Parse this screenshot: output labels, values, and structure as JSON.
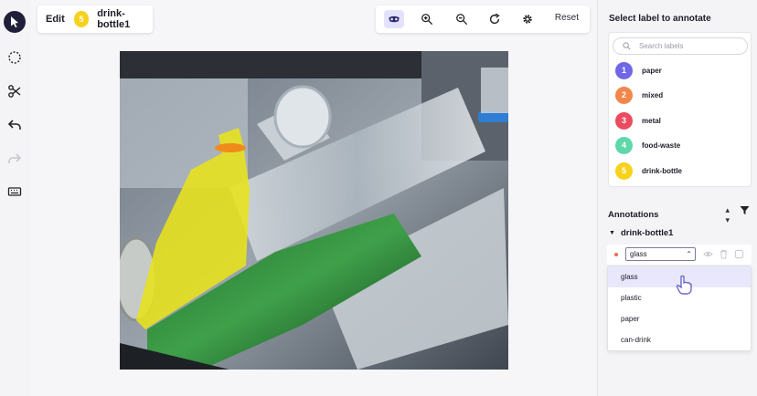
{
  "toolbar": {
    "tools": [
      {
        "name": "select-tool",
        "icon": "pointer-icon"
      },
      {
        "name": "lasso-tool",
        "icon": "dashed-circle-icon"
      },
      {
        "name": "cut-tool",
        "icon": "scissors-icon"
      },
      {
        "name": "undo-tool",
        "icon": "undo-icon"
      },
      {
        "name": "redo-tool",
        "icon": "redo-icon"
      },
      {
        "name": "keyboard-tool",
        "icon": "keyboard-icon"
      }
    ]
  },
  "editor": {
    "mode_label": "Edit",
    "selected_badge": "5",
    "selected_name": "drink-bottle1",
    "selected_color": "#f6d21b"
  },
  "view_controls": {
    "reset_label": "Reset",
    "buttons": [
      "mask-visibility-icon",
      "zoom-in-icon",
      "zoom-out-icon",
      "rotate-icon",
      "settings-gear-icon"
    ]
  },
  "panel": {
    "title": "Select label to annotate",
    "search_placeholder": "Search labels",
    "labels": [
      {
        "num": "1",
        "name": "paper",
        "color": "#6f67e8"
      },
      {
        "num": "2",
        "name": "mixed",
        "color": "#f2874c"
      },
      {
        "num": "3",
        "name": "metal",
        "color": "#ea4b5f"
      },
      {
        "num": "4",
        "name": "food-waste",
        "color": "#5fd7ab"
      },
      {
        "num": "5",
        "name": "drink-bottle",
        "color": "#f6d21b"
      }
    ]
  },
  "annotations": {
    "title": "Annotations",
    "group_name": "drink-bottle1",
    "selected_value": "glass",
    "options": [
      "glass",
      "plastic",
      "paper",
      "can-drink"
    ]
  }
}
